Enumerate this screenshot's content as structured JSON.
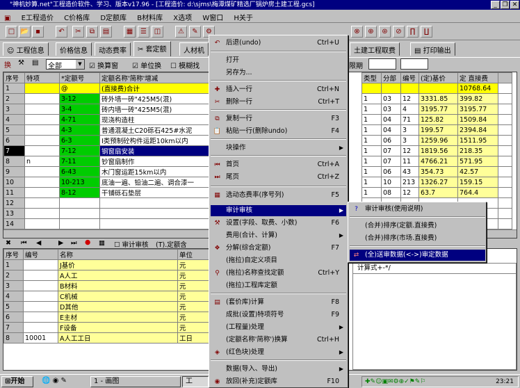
{
  "title": "\"神机妙算.net\"工程造价软件、学习、版本v17.96 - [工程造价: d:\\sjms\\梅潭煤矿精选厂锅炉房土建工程.gcs]",
  "window_buttons": [
    "_",
    "❐",
    "✕"
  ],
  "menubar": [
    "E工程造价",
    "C价格库",
    "D定额库",
    "B材料库",
    "X选项",
    "W窗口",
    "H关于"
  ],
  "tabs": [
    "工程信息",
    "价格信息",
    "动态费率",
    "套定额",
    "人材机",
    "土建工程取费",
    "打印输出"
  ],
  "options": {
    "select": "全部",
    "c1": "换算窗",
    "c2": "单位换",
    "c3": "模糊找",
    "date": "限期"
  },
  "upper_headers": [
    "序号",
    "特项",
    "*定额号",
    "定额名称'简称'增减"
  ],
  "upper_right_headers": [
    "类型",
    "分部",
    "编号",
    "(定)基价",
    "定 直接费"
  ],
  "upper_rows": [
    {
      "no": "1",
      "sp": "",
      "code": "@",
      "name": "(直接费)合计",
      "t": "",
      "b": "",
      "n": "",
      "p": "",
      "d": "10768.64"
    },
    {
      "no": "2",
      "sp": "",
      "code": "3-12",
      "name": "砖外墙一砖\"425M5(混)",
      "t": "1",
      "b": "03",
      "n": "12",
      "p": "3331.85",
      "d": "399.82"
    },
    {
      "no": "3",
      "sp": "",
      "code": "3-4",
      "name": "砖内墙一砖\"425M5(混)",
      "t": "1",
      "b": "03",
      "n": "4",
      "p": "3195.77",
      "d": "3195.77"
    },
    {
      "no": "4",
      "sp": "",
      "code": "4-71",
      "name": "现浇构造柱",
      "t": "1",
      "b": "04",
      "n": "71",
      "p": "125.82",
      "d": "1509.84"
    },
    {
      "no": "5",
      "sp": "",
      "code": "4-3",
      "name": "普通混凝土C20砾石425#水泥",
      "t": "1",
      "b": "04",
      "n": "3",
      "p": "199.57",
      "d": "2394.84"
    },
    {
      "no": "6",
      "sp": "",
      "code": "6-3",
      "name": "Ⅰ类预制砼构件运距10km以内",
      "t": "1",
      "b": "06",
      "n": "3",
      "p": "1259.96",
      "d": "1511.95"
    },
    {
      "no": "7",
      "sp": "",
      "code": "7-12",
      "name": "钢窗扇安装",
      "t": "1",
      "b": "07",
      "n": "12",
      "p": "1819.56",
      "d": "218.35"
    },
    {
      "no": "8",
      "sp": "n",
      "code": "7-11",
      "name": "钞窗扇制作",
      "t": "1",
      "b": "07",
      "n": "11",
      "p": "4766.21",
      "d": "571.95"
    },
    {
      "no": "9",
      "sp": "",
      "code": "6-43",
      "name": "木门窗运距15km以内",
      "t": "1",
      "b": "06",
      "n": "43",
      "p": "354.73",
      "d": "42.57"
    },
    {
      "no": "10",
      "sp": "",
      "code": "10-213",
      "name": "底油一遍、铅油二遍、调合漆一",
      "t": "1",
      "b": "10",
      "n": "213",
      "p": "1326.27",
      "d": "159.15"
    },
    {
      "no": "11",
      "sp": "",
      "code": "8-12",
      "name": "干铺砾石垫层",
      "t": "1",
      "b": "08",
      "n": "12",
      "p": "63.7",
      "d": "764.4"
    },
    {
      "no": "12",
      "sp": "",
      "code": "",
      "name": "",
      "t": "",
      "b": "",
      "n": "",
      "p": "",
      "d": ""
    },
    {
      "no": "13",
      "sp": "",
      "code": "",
      "name": "",
      "t": "",
      "b": "",
      "n": "",
      "p": "",
      "d": ""
    },
    {
      "no": "14",
      "sp": "",
      "code": "",
      "name": "",
      "t": "",
      "b": "",
      "n": "",
      "p": "",
      "d": ""
    }
  ],
  "navbar": {
    "audit": "审计审核",
    "hint": "(T).定额含"
  },
  "lower_headers": [
    "序号",
    "编号",
    "名称",
    "单位"
  ],
  "lower_right_header": "计算式+-*/",
  "lower_rows": [
    {
      "no": "1",
      "code": "",
      "name": "J基价",
      "unit": "元"
    },
    {
      "no": "2",
      "code": "",
      "name": "A人工",
      "unit": "元"
    },
    {
      "no": "3",
      "code": "",
      "name": "B材料",
      "unit": "元"
    },
    {
      "no": "4",
      "code": "",
      "name": "C机械",
      "unit": "元"
    },
    {
      "no": "5",
      "code": "",
      "name": "D其他",
      "unit": "元"
    },
    {
      "no": "6",
      "code": "",
      "name": "E主材",
      "unit": "元"
    },
    {
      "no": "7",
      "code": "",
      "name": "F设备",
      "unit": "元"
    },
    {
      "no": "8",
      "code": "10001",
      "name": "A人工工日",
      "unit": "工日"
    }
  ],
  "ctx_items": [
    {
      "label": "后退(undo)",
      "sc": "Ctrl+U",
      "ic": "↶"
    },
    {
      "label": "打开",
      "sc": "",
      "ic": ""
    },
    {
      "label": "另存为...",
      "sc": "",
      "ic": ""
    },
    {
      "label": "插入一行",
      "sc": "Ctrl+N",
      "ic": "✚"
    },
    {
      "label": "删除一行",
      "sc": "Ctrl+T",
      "ic": "✂"
    },
    {
      "label": "复制一行",
      "sc": "F3",
      "ic": "⧉"
    },
    {
      "label": "粘贴一行(删除undo)",
      "sc": "F4",
      "ic": "📋"
    },
    {
      "label": "块操作",
      "sc": "",
      "ic": "",
      "sub": true
    },
    {
      "label": "首页",
      "sc": "Ctrl+A",
      "ic": "⏮"
    },
    {
      "label": "尾页",
      "sc": "Ctrl+Z",
      "ic": "⏭"
    },
    {
      "label": "选动态费率(序号列)",
      "sc": "F5",
      "ic": "▦"
    },
    {
      "label": "审计审核",
      "sc": "",
      "ic": "",
      "sub": true
    },
    {
      "label": "设置(字段、取费、小数)",
      "sc": "F6",
      "ic": "⚒"
    },
    {
      "label": "费用(合计、计算)",
      "sc": "",
      "ic": "",
      "sub": true
    },
    {
      "label": "分解(综合定额)",
      "sc": "F7",
      "ic": "❖"
    },
    {
      "label": "(拖拉)自定义项目",
      "sc": "",
      "ic": ""
    },
    {
      "label": "(拖拉)名称查找定额",
      "sc": "Ctrl+Y",
      "ic": "⚲"
    },
    {
      "label": "(拖拉)工程库定额",
      "sc": "",
      "ic": ""
    },
    {
      "label": "(套价库)计算",
      "sc": "F8",
      "ic": "▤"
    },
    {
      "label": "成批(设置)特项符号",
      "sc": "F9",
      "ic": ""
    },
    {
      "label": "(工程量)处理",
      "sc": "",
      "ic": "",
      "sub": true
    },
    {
      "label": "(定额名称'简称')换算",
      "sc": "Ctrl+H",
      "ic": ""
    },
    {
      "label": "(红色块)处理",
      "sc": "",
      "ic": "◈",
      "sub": true
    },
    {
      "label": "数据(导入、导出)",
      "sc": "",
      "ic": "",
      "sub": true
    },
    {
      "label": "放回(补充)定额库",
      "sc": "F10",
      "ic": "◉"
    }
  ],
  "sub_items": [
    "审计审核(使用说明)",
    "(合并)排序(定额.直接费)",
    "(合并)排序(市场.直接费)",
    "(全)送审数据(<->)审定数据"
  ],
  "taskbar": {
    "start": "开始",
    "win1": "1 - 画图",
    "win2": "工",
    "clock": "23:21"
  }
}
